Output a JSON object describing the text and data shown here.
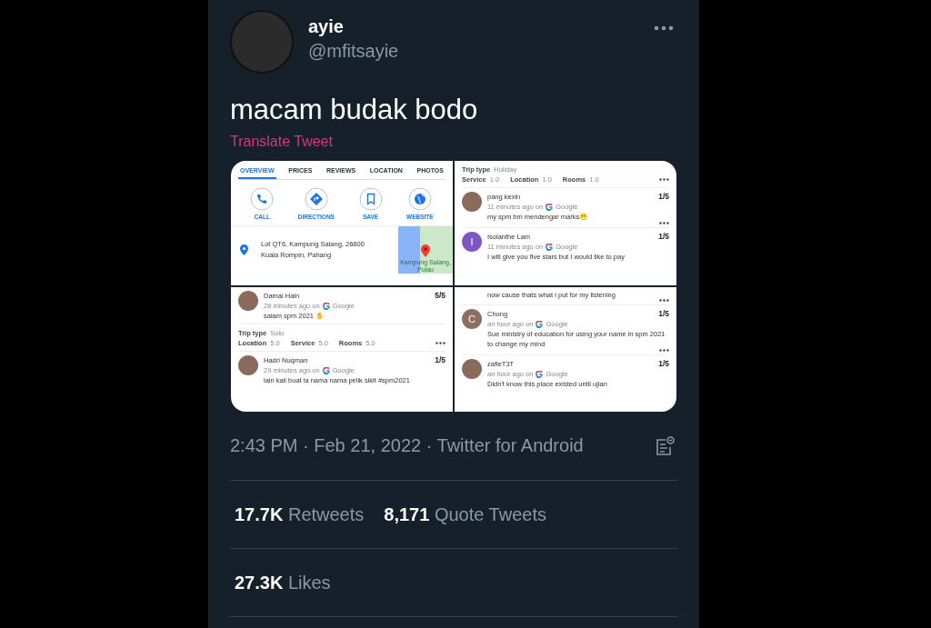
{
  "author": {
    "name": "ayie",
    "handle": "@mfitsayie"
  },
  "tweet": {
    "text": "macam budak bodo",
    "translate": "Translate Tweet"
  },
  "media": [
    {
      "kind": "place",
      "tabs": [
        {
          "label": "OVERVIEW",
          "selected": true
        },
        {
          "label": "PRICES",
          "selected": false
        },
        {
          "label": "REVIEWS",
          "selected": false
        },
        {
          "label": "LOCATION",
          "selected": false
        },
        {
          "label": "PHOTOS",
          "selected": false
        }
      ],
      "actions": [
        {
          "label": "CALL",
          "kind": "phone"
        },
        {
          "label": "DIRECTIONS",
          "kind": "directions"
        },
        {
          "label": "SAVE",
          "kind": "bookmark"
        },
        {
          "label": "WEBSITE",
          "kind": "globe"
        }
      ],
      "address": "Lot QT6, Kampung Salang, 26800 Kuala Rompin, Pahang",
      "map_label": "Kampung Salang, Pulau"
    },
    {
      "kind": "reviews",
      "blocks": [
        {
          "kind": "trip",
          "trip_label": "Trip type",
          "trip_value": "Holiday",
          "scores": [
            {
              "label": "Service",
              "value": "1.0"
            },
            {
              "label": "Location",
              "value": "1.0"
            },
            {
              "label": "Rooms",
              "value": "1.0"
            }
          ],
          "more": true
        },
        {
          "kind": "review",
          "name": "pang kexin",
          "rating": "1/5",
          "time": "11 minutes ago on",
          "source": "Google",
          "text": "my spm bm mendengar marks😬",
          "more": true
        },
        {
          "kind": "review",
          "letter": "I",
          "color": "#7e57c2",
          "name": "Isolanthe Lam",
          "rating": "1/5",
          "time": "11 minutes ago on",
          "source": "Google",
          "text": "I will give you five stars but I would like to pay",
          "more": false
        }
      ]
    },
    {
      "kind": "reviews",
      "blocks": [
        {
          "kind": "review",
          "name": "Damai Hain",
          "rating": "5/5",
          "time": "28 minutes ago on",
          "source": "Google",
          "text": "salam spm 2021 ✋",
          "more": false
        },
        {
          "kind": "trip",
          "trip_label": "Trip type",
          "trip_value": "Solo",
          "scores": [
            {
              "label": "Location",
              "value": "5.0"
            },
            {
              "label": "Service",
              "value": "5.0"
            },
            {
              "label": "Rooms",
              "value": "5.0"
            }
          ],
          "more": true
        },
        {
          "kind": "review",
          "name": "Hadri Nuqman",
          "rating": "1/5",
          "time": "29 minutes ago on",
          "source": "Google",
          "text": "lain kali buat la nama nama pelik sikit #spm2021",
          "more": false
        }
      ]
    },
    {
      "kind": "reviews",
      "blocks": [
        {
          "kind": "text",
          "text": "now cause thats what i put for my listening",
          "more": true
        },
        {
          "kind": "review",
          "letter": "C",
          "color": "#8d6e63",
          "name": "Chong",
          "rating": "1/5",
          "time": "an hour ago on",
          "source": "Google",
          "text": "Sue ministry of education for using your name in spm 2021 to change my mind",
          "more": true
        },
        {
          "kind": "review",
          "name": "zafieT3T",
          "rating": "1/5",
          "time": "an hour ago on",
          "source": "Google",
          "text": "Didn't know this place existed until ujian",
          "more": false
        }
      ]
    }
  ],
  "meta": "2:43 PM · Feb 21, 2022 · Twitter for Android",
  "stats": [
    {
      "count": "17.7K",
      "label": "Retweets"
    },
    {
      "count": "8,171",
      "label": "Quote Tweets"
    }
  ],
  "likes": {
    "count": "27.3K",
    "label": "Likes"
  }
}
